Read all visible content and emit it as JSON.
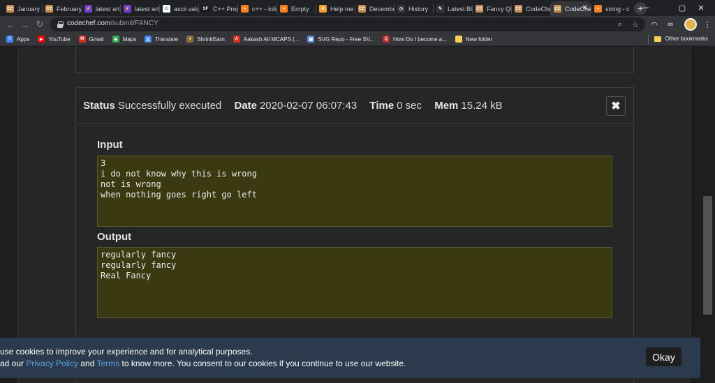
{
  "tabs": [
    {
      "title": "January",
      "icon": "CC",
      "color": "#c38d55"
    },
    {
      "title": "February",
      "icon": "CC",
      "color": "#c38d55"
    },
    {
      "title": "latest articles",
      "icon": "⚡",
      "color": "#6d3fd6"
    },
    {
      "title": "latest articles",
      "icon": "⚡",
      "color": "#6d3fd6"
    },
    {
      "title": "ascii value",
      "icon": "G",
      "color": "#ffffff"
    },
    {
      "title": "C++ Programs",
      "icon": "SF",
      "color": "#1b1b1b"
    },
    {
      "title": "c++ - inline",
      "icon": "≈",
      "color": "#f48024"
    },
    {
      "title": "Empty",
      "icon": "≈",
      "color": "#f48024"
    },
    {
      "title": "Help me",
      "icon": "H",
      "color": "#f0a030"
    },
    {
      "title": "December",
      "icon": "CC",
      "color": "#c38d55"
    },
    {
      "title": "History",
      "icon": "◷",
      "color": "#35363a"
    },
    {
      "title": "Latest Blog",
      "icon": "✎",
      "color": "#35363a"
    },
    {
      "title": "Fancy Quote",
      "icon": "CC",
      "color": "#c38d55"
    },
    {
      "title": "CodeChef",
      "icon": "CC",
      "color": "#c38d55"
    },
    {
      "title": "CodeChef",
      "icon": "CC",
      "color": "#c38d55",
      "active": true
    },
    {
      "title": "string - c++",
      "icon": "≈",
      "color": "#f48024"
    }
  ],
  "address": {
    "host": "codechef.com",
    "path": "/submit/FANCY"
  },
  "bookmarks": [
    {
      "label": "Apps",
      "icon": "⁞⁞",
      "color": "#4285f4"
    },
    {
      "label": "YouTube",
      "icon": "▶",
      "color": "#ff0000"
    },
    {
      "label": "Gmail",
      "icon": "M",
      "color": "#d93025"
    },
    {
      "label": "Maps",
      "icon": "◆",
      "color": "#34a853"
    },
    {
      "label": "Translate",
      "icon": "文",
      "color": "#4285f4"
    },
    {
      "label": "ShrinkEarn",
      "icon": "♦",
      "color": "#8a6d3b"
    },
    {
      "label": "Aakash All MCAPS (...",
      "icon": "A",
      "color": "#d93025"
    },
    {
      "label": "SVG Repo - Free SV...",
      "icon": "▦",
      "color": "#5b8fd6"
    },
    {
      "label": "How Do I become a...",
      "icon": "Q",
      "color": "#b92b27"
    },
    {
      "label": "New folder",
      "icon": "",
      "color": "#f5cf5a"
    }
  ],
  "other_bookmarks": "Other bookmarks",
  "status": {
    "status_label": "Status",
    "status_value": "Successfully executed",
    "date_label": "Date",
    "date_value": "2020-02-07 06:07:43",
    "time_label": "Time",
    "time_value": "0 sec",
    "mem_label": "Mem",
    "mem_value": "15.24 kB"
  },
  "close_symbol": "✖",
  "input": {
    "label": "Input",
    "lines": [
      "3",
      "i do not know why this is wrong",
      "not is wrong",
      "when nothing goes right go left"
    ]
  },
  "output": {
    "label": "Output",
    "lines": [
      "regularly fancy",
      "regularly fancy",
      "Real Fancy"
    ]
  },
  "cookie": {
    "line1": "use cookies to improve your experience and for analytical purposes.",
    "line2_a": "ad our ",
    "privacy": "Privacy Policy",
    "and": " and ",
    "terms": "Terms",
    "line2_b": " to know more. You consent to our cookies if you continue to use our website.",
    "okay": "Okay"
  },
  "colors": {
    "panel_bg": "#3a3912",
    "banner_bg": "#2c3a4d",
    "link": "#5aa2e8"
  }
}
